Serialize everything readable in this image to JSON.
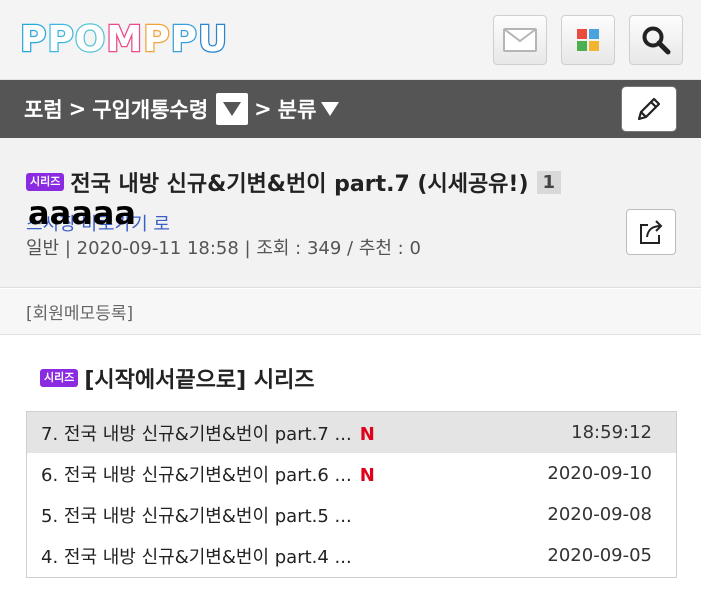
{
  "header": {
    "logo_letters": [
      "P",
      "P",
      "O",
      "M",
      "P",
      "P",
      "U"
    ]
  },
  "breadcrumb": {
    "forum": "포럼",
    "separator": ">",
    "board": "구입개통수령",
    "category": "분류"
  },
  "post": {
    "badge": "시리즈",
    "title": "전국 내방 신규&기변&번이 part.7 (시세공유!)",
    "comment_count": "1",
    "author_link_partial": "스시짱 바로가기 로",
    "author_name_overlay": "aaaaa",
    "meta": "일반 | 2020-09-11 18:58 | 조회 : 349 / 추천 : 0"
  },
  "memo": {
    "label": "[회원메모등록]"
  },
  "series": {
    "badge": "시리즈",
    "title": "[시작에서끝으로] 시리즈",
    "items": [
      {
        "text": "7. 전국 내방 신규&기변&번이 part.7 ...",
        "new": "N",
        "date": "18:59:12"
      },
      {
        "text": "6. 전국 내방 신규&기변&번이 part.6 ...",
        "new": "N",
        "date": "2020-09-10"
      },
      {
        "text": "5. 전국 내방 신규&기변&번이 part.5 ...",
        "new": "",
        "date": "2020-09-08"
      },
      {
        "text": "4. 전국 내방 신규&기변&번이 part.4 ...",
        "new": "",
        "date": "2020-09-05"
      }
    ]
  },
  "colors": {
    "badge": "#8a2be2",
    "new_marker": "#e0001a",
    "crumb_bar": "#555555"
  }
}
